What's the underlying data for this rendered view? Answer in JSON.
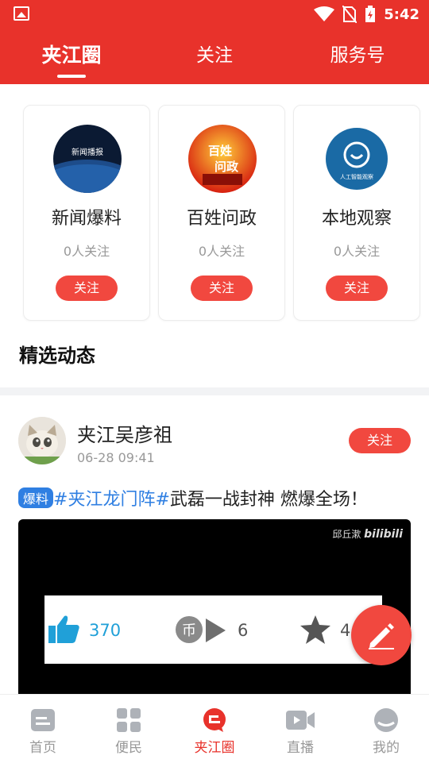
{
  "status_bar": {
    "time": "5:42",
    "icons": [
      "image-icon",
      "wifi-icon",
      "no-sim-icon",
      "battery-charging-icon"
    ]
  },
  "top_tabs": [
    {
      "label": "夹江圈",
      "active": true
    },
    {
      "label": "关注",
      "active": false
    },
    {
      "label": "服务号",
      "active": false
    }
  ],
  "service_cards": [
    {
      "name": "新闻爆料",
      "followers": "0人关注",
      "follow_label": "关注",
      "logo_text": "新闻播报"
    },
    {
      "name": "百姓问政",
      "followers": "0人关注",
      "follow_label": "关注",
      "logo_text": "百姓问政"
    },
    {
      "name": "本地观察",
      "followers": "0人关注",
      "follow_label": "关注",
      "logo_text": "人工智能观察"
    }
  ],
  "section_title": "精选动态",
  "post": {
    "author": "夹江吴彦祖",
    "time": "06-28 09:41",
    "follow_label": "关注",
    "tag": "爆料",
    "topic": "#夹江龙门阵#",
    "text": "武磊一战封神  燃爆全场！",
    "video": {
      "watermark_name": "邱丘漱",
      "watermark_brand": "bilibili",
      "likes": "370",
      "coins": "6",
      "favorites": "4"
    }
  },
  "fab": {
    "icon": "pencil-icon"
  },
  "bottom_nav": [
    {
      "label": "首页",
      "icon": "home-icon",
      "active": false
    },
    {
      "label": "便民",
      "icon": "grid-icon",
      "active": false
    },
    {
      "label": "夹江圈",
      "icon": "chat-icon",
      "active": true
    },
    {
      "label": "直播",
      "icon": "video-camera-icon",
      "active": false
    },
    {
      "label": "我的",
      "icon": "profile-icon",
      "active": false
    }
  ],
  "colors": {
    "brand": "#e8322b",
    "button": "#f1483f",
    "topic": "#2f7fe2"
  }
}
